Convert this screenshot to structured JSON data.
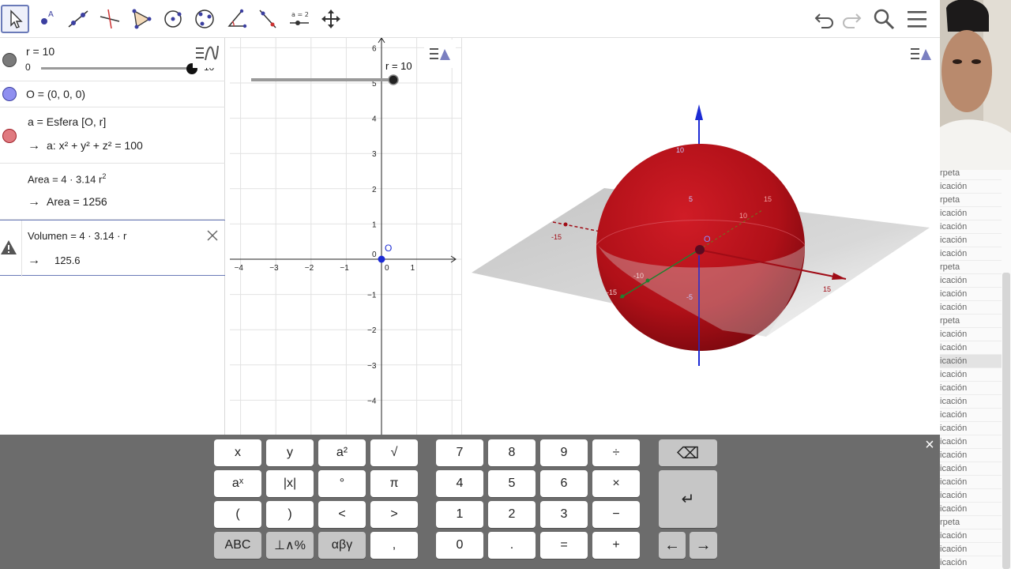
{
  "toolbar": {
    "tools": [
      "move-tool",
      "point-tool",
      "line-tool",
      "perpendicular-tool",
      "polygon-tool",
      "circle-tool",
      "circle-through-points-tool",
      "angle-tool",
      "reflect-tool",
      "slider-tool",
      "move-view-tool"
    ],
    "slider_tool_label": "a = 2",
    "right_icons": [
      "undo-icon",
      "redo-icon",
      "search-icon",
      "menu-icon"
    ]
  },
  "algebra": {
    "r_def": "r = 10",
    "r_slider_min": "0",
    "r_slider_max": "10",
    "r_value_fraction": 1.0,
    "o_def": "O = (0, 0, 0)",
    "a_def": "a = Esfera [O, r]",
    "a_out": "a: x² + y² + z² = 100",
    "area_def": "Area = 4 · 3.14 r",
    "area_exp": "2",
    "area_out": "Area = 1256",
    "vol_def": "Volumen = 4 · 3.14 · r",
    "vol_out": "125.6",
    "arrow": "→",
    "marker_colors": {
      "r": "#7a7a7a",
      "O": "#8f8ff0",
      "a": "#e07a80"
    },
    "warning_icon": "warning-icon",
    "close_icon": "close-icon"
  },
  "graphics2d": {
    "slider_label": "r = 10",
    "point_label": "O",
    "x_ticks": [
      "−4",
      "−3",
      "−2",
      "−1",
      "0",
      "1"
    ],
    "y_ticks": [
      "6",
      "5",
      "4",
      "3",
      "2",
      "1",
      "0",
      "−1",
      "−2",
      "−3",
      "−4"
    ]
  },
  "graphics3d": {
    "axis_labels": [
      "-15",
      "-10",
      "15",
      "10",
      "15",
      "-15",
      "-10",
      "10",
      "5",
      "-5",
      "-10"
    ],
    "point_label": "O",
    "sphere_color": "#b01018"
  },
  "filelist": {
    "items": [
      "rpeta",
      "icación",
      "rpeta",
      "icación",
      "icación",
      "icación",
      "icación",
      "rpeta",
      "icación",
      "icación",
      "icación",
      "rpeta",
      "icación",
      "icación",
      "icación",
      "icación",
      "icación",
      "icación",
      "icación",
      "icación",
      "icación",
      "icación",
      "icación",
      "icación",
      "icación",
      "icación",
      "rpeta",
      "icación",
      "icación",
      "icación"
    ],
    "highlight_index": 14
  },
  "keyboard": {
    "row1": [
      "x",
      "y",
      "a²",
      "√",
      "7",
      "8",
      "9",
      "÷"
    ],
    "row2": [
      "aˣ",
      "|x|",
      "°",
      "π",
      "4",
      "5",
      "6",
      "×"
    ],
    "row3": [
      "(",
      ")",
      "<",
      ">",
      "1",
      "2",
      "3",
      "−"
    ],
    "row4": [
      "ABC",
      "⊥∧%",
      "αβγ",
      ",",
      "0",
      ".",
      "=",
      "+"
    ],
    "backspace": "⌫",
    "enter": "↵",
    "left": "←",
    "right": "→",
    "close": "×"
  }
}
